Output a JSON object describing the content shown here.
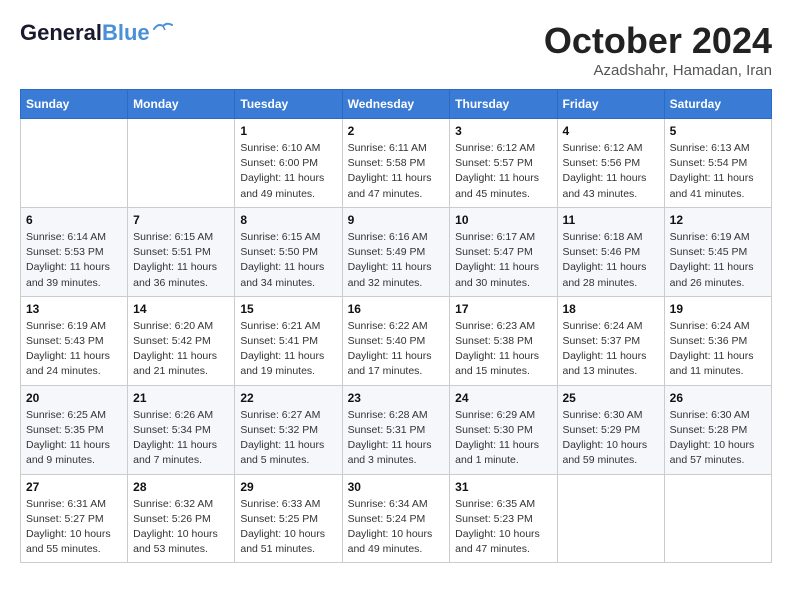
{
  "header": {
    "logo_line1": "General",
    "logo_line2": "Blue",
    "month_title": "October 2024",
    "subtitle": "Azadshahr, Hamadan, Iran"
  },
  "weekdays": [
    "Sunday",
    "Monday",
    "Tuesday",
    "Wednesday",
    "Thursday",
    "Friday",
    "Saturday"
  ],
  "weeks": [
    [
      {
        "day": "",
        "sunrise": "",
        "sunset": "",
        "daylight": ""
      },
      {
        "day": "",
        "sunrise": "",
        "sunset": "",
        "daylight": ""
      },
      {
        "day": "1",
        "sunrise": "Sunrise: 6:10 AM",
        "sunset": "Sunset: 6:00 PM",
        "daylight": "Daylight: 11 hours and 49 minutes."
      },
      {
        "day": "2",
        "sunrise": "Sunrise: 6:11 AM",
        "sunset": "Sunset: 5:58 PM",
        "daylight": "Daylight: 11 hours and 47 minutes."
      },
      {
        "day": "3",
        "sunrise": "Sunrise: 6:12 AM",
        "sunset": "Sunset: 5:57 PM",
        "daylight": "Daylight: 11 hours and 45 minutes."
      },
      {
        "day": "4",
        "sunrise": "Sunrise: 6:12 AM",
        "sunset": "Sunset: 5:56 PM",
        "daylight": "Daylight: 11 hours and 43 minutes."
      },
      {
        "day": "5",
        "sunrise": "Sunrise: 6:13 AM",
        "sunset": "Sunset: 5:54 PM",
        "daylight": "Daylight: 11 hours and 41 minutes."
      }
    ],
    [
      {
        "day": "6",
        "sunrise": "Sunrise: 6:14 AM",
        "sunset": "Sunset: 5:53 PM",
        "daylight": "Daylight: 11 hours and 39 minutes."
      },
      {
        "day": "7",
        "sunrise": "Sunrise: 6:15 AM",
        "sunset": "Sunset: 5:51 PM",
        "daylight": "Daylight: 11 hours and 36 minutes."
      },
      {
        "day": "8",
        "sunrise": "Sunrise: 6:15 AM",
        "sunset": "Sunset: 5:50 PM",
        "daylight": "Daylight: 11 hours and 34 minutes."
      },
      {
        "day": "9",
        "sunrise": "Sunrise: 6:16 AM",
        "sunset": "Sunset: 5:49 PM",
        "daylight": "Daylight: 11 hours and 32 minutes."
      },
      {
        "day": "10",
        "sunrise": "Sunrise: 6:17 AM",
        "sunset": "Sunset: 5:47 PM",
        "daylight": "Daylight: 11 hours and 30 minutes."
      },
      {
        "day": "11",
        "sunrise": "Sunrise: 6:18 AM",
        "sunset": "Sunset: 5:46 PM",
        "daylight": "Daylight: 11 hours and 28 minutes."
      },
      {
        "day": "12",
        "sunrise": "Sunrise: 6:19 AM",
        "sunset": "Sunset: 5:45 PM",
        "daylight": "Daylight: 11 hours and 26 minutes."
      }
    ],
    [
      {
        "day": "13",
        "sunrise": "Sunrise: 6:19 AM",
        "sunset": "Sunset: 5:43 PM",
        "daylight": "Daylight: 11 hours and 24 minutes."
      },
      {
        "day": "14",
        "sunrise": "Sunrise: 6:20 AM",
        "sunset": "Sunset: 5:42 PM",
        "daylight": "Daylight: 11 hours and 21 minutes."
      },
      {
        "day": "15",
        "sunrise": "Sunrise: 6:21 AM",
        "sunset": "Sunset: 5:41 PM",
        "daylight": "Daylight: 11 hours and 19 minutes."
      },
      {
        "day": "16",
        "sunrise": "Sunrise: 6:22 AM",
        "sunset": "Sunset: 5:40 PM",
        "daylight": "Daylight: 11 hours and 17 minutes."
      },
      {
        "day": "17",
        "sunrise": "Sunrise: 6:23 AM",
        "sunset": "Sunset: 5:38 PM",
        "daylight": "Daylight: 11 hours and 15 minutes."
      },
      {
        "day": "18",
        "sunrise": "Sunrise: 6:24 AM",
        "sunset": "Sunset: 5:37 PM",
        "daylight": "Daylight: 11 hours and 13 minutes."
      },
      {
        "day": "19",
        "sunrise": "Sunrise: 6:24 AM",
        "sunset": "Sunset: 5:36 PM",
        "daylight": "Daylight: 11 hours and 11 minutes."
      }
    ],
    [
      {
        "day": "20",
        "sunrise": "Sunrise: 6:25 AM",
        "sunset": "Sunset: 5:35 PM",
        "daylight": "Daylight: 11 hours and 9 minutes."
      },
      {
        "day": "21",
        "sunrise": "Sunrise: 6:26 AM",
        "sunset": "Sunset: 5:34 PM",
        "daylight": "Daylight: 11 hours and 7 minutes."
      },
      {
        "day": "22",
        "sunrise": "Sunrise: 6:27 AM",
        "sunset": "Sunset: 5:32 PM",
        "daylight": "Daylight: 11 hours and 5 minutes."
      },
      {
        "day": "23",
        "sunrise": "Sunrise: 6:28 AM",
        "sunset": "Sunset: 5:31 PM",
        "daylight": "Daylight: 11 hours and 3 minutes."
      },
      {
        "day": "24",
        "sunrise": "Sunrise: 6:29 AM",
        "sunset": "Sunset: 5:30 PM",
        "daylight": "Daylight: 11 hours and 1 minute."
      },
      {
        "day": "25",
        "sunrise": "Sunrise: 6:30 AM",
        "sunset": "Sunset: 5:29 PM",
        "daylight": "Daylight: 10 hours and 59 minutes."
      },
      {
        "day": "26",
        "sunrise": "Sunrise: 6:30 AM",
        "sunset": "Sunset: 5:28 PM",
        "daylight": "Daylight: 10 hours and 57 minutes."
      }
    ],
    [
      {
        "day": "27",
        "sunrise": "Sunrise: 6:31 AM",
        "sunset": "Sunset: 5:27 PM",
        "daylight": "Daylight: 10 hours and 55 minutes."
      },
      {
        "day": "28",
        "sunrise": "Sunrise: 6:32 AM",
        "sunset": "Sunset: 5:26 PM",
        "daylight": "Daylight: 10 hours and 53 minutes."
      },
      {
        "day": "29",
        "sunrise": "Sunrise: 6:33 AM",
        "sunset": "Sunset: 5:25 PM",
        "daylight": "Daylight: 10 hours and 51 minutes."
      },
      {
        "day": "30",
        "sunrise": "Sunrise: 6:34 AM",
        "sunset": "Sunset: 5:24 PM",
        "daylight": "Daylight: 10 hours and 49 minutes."
      },
      {
        "day": "31",
        "sunrise": "Sunrise: 6:35 AM",
        "sunset": "Sunset: 5:23 PM",
        "daylight": "Daylight: 10 hours and 47 minutes."
      },
      {
        "day": "",
        "sunrise": "",
        "sunset": "",
        "daylight": ""
      },
      {
        "day": "",
        "sunrise": "",
        "sunset": "",
        "daylight": ""
      }
    ]
  ]
}
